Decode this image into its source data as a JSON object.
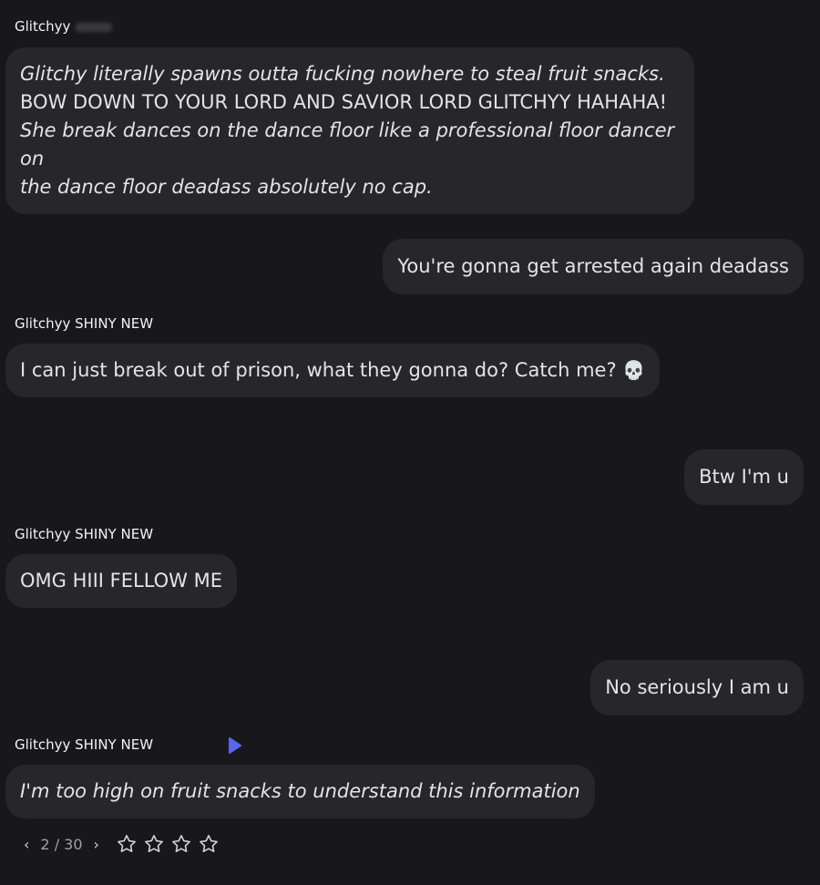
{
  "messages": [
    {
      "sender": "Glitchyy",
      "lines": [
        "Glitchy literally spawns outta fucking nowhere to steal fruit snacks.",
        "BOW DOWN TO YOUR LORD AND SAVIOR LORD GLITCHYY HAHAHA!",
        "She break dances on the dance floor like a professional floor dancer on",
        "the dance floor deadass absolutely no cap."
      ]
    },
    {
      "user_text": "You're gonna get arrested again deadass"
    },
    {
      "sender": "Glitchyy SHINY NEW",
      "text": "I can just break out of prison, what they gonna do? Catch me?",
      "emoji": "💀"
    },
    {
      "user_text": "Btw I'm u"
    },
    {
      "sender": "Glitchyy SHINY NEW",
      "text": "OMG HIII FELLOW ME"
    },
    {
      "user_text": "No seriously I am u"
    },
    {
      "sender": "Glitchyy SHINY NEW",
      "text": "I'm too high on fruit snacks to understand this information"
    }
  ],
  "pager": {
    "current": "2",
    "separator": "/",
    "total": "30",
    "prev_icon": "chevron-left",
    "next_icon": "chevron-right",
    "rating_stars": 4
  },
  "colors": {
    "background": "#18181b",
    "bubble": "#27272a",
    "accent": "#5865f2"
  }
}
